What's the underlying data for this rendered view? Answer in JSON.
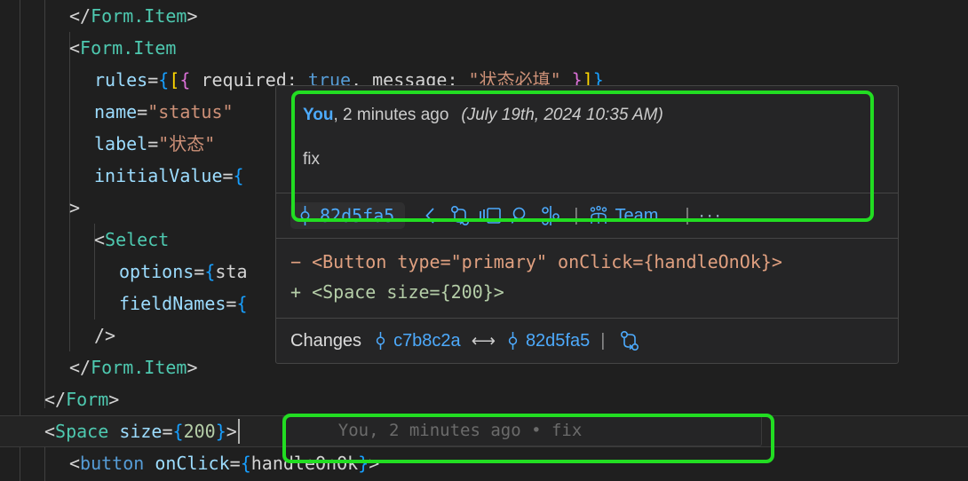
{
  "editor": {
    "lines": [
      {
        "indent": 2,
        "tokens": [
          {
            "t": "</",
            "c": "t-punc"
          },
          {
            "t": "Form.Item",
            "c": "t-tag"
          },
          {
            "t": ">",
            "c": "t-punc"
          }
        ]
      },
      {
        "indent": 2,
        "tokens": [
          {
            "t": "<",
            "c": "t-punc"
          },
          {
            "t": "Form.Item",
            "c": "t-tag"
          }
        ]
      },
      {
        "indent": 3,
        "tokens": [
          {
            "t": "rules",
            "c": "t-attr"
          },
          {
            "t": "=",
            "c": "t-punc"
          },
          {
            "t": "{",
            "c": "t-brace"
          },
          {
            "t": "[",
            "c": "t-brace2"
          },
          {
            "t": "{",
            "c": "t-brace3"
          },
          {
            "t": " required",
            "c": "t-plain"
          },
          {
            "t": ": ",
            "c": "t-punc"
          },
          {
            "t": "true",
            "c": "t-kw"
          },
          {
            "t": ", ",
            "c": "t-punc"
          },
          {
            "t": "message",
            "c": "t-plain"
          },
          {
            "t": ": ",
            "c": "t-punc"
          },
          {
            "t": "\"状态必填\"",
            "c": "t-str"
          },
          {
            "t": " ",
            "c": "t-punc"
          },
          {
            "t": "}",
            "c": "t-brace3"
          },
          {
            "t": "]",
            "c": "t-brace2"
          },
          {
            "t": "}",
            "c": "t-brace"
          }
        ]
      },
      {
        "indent": 3,
        "tokens": [
          {
            "t": "name",
            "c": "t-attr"
          },
          {
            "t": "=",
            "c": "t-punc"
          },
          {
            "t": "\"status\"",
            "c": "t-str"
          }
        ]
      },
      {
        "indent": 3,
        "tokens": [
          {
            "t": "label",
            "c": "t-attr"
          },
          {
            "t": "=",
            "c": "t-punc"
          },
          {
            "t": "\"状态\"",
            "c": "t-str"
          }
        ]
      },
      {
        "indent": 3,
        "tokens": [
          {
            "t": "initialValue",
            "c": "t-attr"
          },
          {
            "t": "=",
            "c": "t-punc"
          },
          {
            "t": "{",
            "c": "t-brace"
          }
        ]
      },
      {
        "indent": 2,
        "tokens": [
          {
            "t": ">",
            "c": "t-punc"
          }
        ]
      },
      {
        "indent": 3,
        "tokens": [
          {
            "t": "<",
            "c": "t-punc"
          },
          {
            "t": "Select",
            "c": "t-tag"
          }
        ]
      },
      {
        "indent": 4,
        "tokens": [
          {
            "t": "options",
            "c": "t-attr"
          },
          {
            "t": "=",
            "c": "t-punc"
          },
          {
            "t": "{",
            "c": "t-brace"
          },
          {
            "t": "sta",
            "c": "t-plain"
          }
        ]
      },
      {
        "indent": 4,
        "tokens": [
          {
            "t": "fieldNames",
            "c": "t-attr"
          },
          {
            "t": "=",
            "c": "t-punc"
          },
          {
            "t": "{",
            "c": "t-brace"
          }
        ]
      },
      {
        "indent": 3,
        "tokens": [
          {
            "t": "/>",
            "c": "t-punc"
          }
        ]
      },
      {
        "indent": 2,
        "tokens": [
          {
            "t": "</",
            "c": "t-punc"
          },
          {
            "t": "Form.Item",
            "c": "t-tag"
          },
          {
            "t": ">",
            "c": "t-punc"
          }
        ]
      },
      {
        "indent": 1,
        "tokens": [
          {
            "t": "</",
            "c": "t-punc"
          },
          {
            "t": "Form",
            "c": "t-tag"
          },
          {
            "t": ">",
            "c": "t-punc"
          }
        ]
      },
      {
        "indent": 1,
        "current": true,
        "tokens": [
          {
            "t": "<",
            "c": "t-punc"
          },
          {
            "t": "Space",
            "c": "t-tag"
          },
          {
            "t": " ",
            "c": "t-punc"
          },
          {
            "t": "size",
            "c": "t-attr"
          },
          {
            "t": "=",
            "c": "t-punc"
          },
          {
            "t": "{",
            "c": "t-brace"
          },
          {
            "t": "200",
            "c": "t-num"
          },
          {
            "t": "}",
            "c": "t-brace"
          },
          {
            "t": ">",
            "c": "t-punc"
          }
        ]
      },
      {
        "indent": 2,
        "tokens": [
          {
            "t": "<",
            "c": "t-punc"
          },
          {
            "t": "button",
            "c": "t-tag2"
          },
          {
            "t": " ",
            "c": "t-punc"
          },
          {
            "t": "onClick",
            "c": "t-attr"
          },
          {
            "t": "=",
            "c": "t-punc"
          },
          {
            "t": "{",
            "c": "t-brace"
          },
          {
            "t": "handleOnOk",
            "c": "t-plain"
          },
          {
            "t": "}",
            "c": "t-brace"
          },
          {
            "t": ">",
            "c": "t-punc"
          }
        ]
      }
    ]
  },
  "hover_panel": {
    "commit_message": {
      "author": "You",
      "relative_time": ", 2 minutes ago",
      "absolute_date": "(July 19th, 2024 10:35 AM)",
      "body": "fix"
    },
    "toolbar": {
      "commit_hash": "82d5fa5",
      "icons": [
        {
          "name": "chevron-left-icon",
          "glyph": "chevron-left"
        },
        {
          "name": "git-compare-icon",
          "glyph": "git-compare"
        },
        {
          "name": "split-view-icon",
          "glyph": "split-view"
        },
        {
          "name": "search-icon",
          "glyph": "magnifier"
        },
        {
          "name": "git-branch-compare-icon",
          "glyph": "branch-compare"
        }
      ],
      "separator": "|",
      "team_label": "Team…",
      "more_label": "···"
    },
    "diff": {
      "removed": "− <Button type=\"primary\" onClick={handleOnOk}>",
      "added": "+ <Space size={200}>"
    },
    "changes": {
      "label": "Changes",
      "from_hash": "c7b8c2a",
      "arrow": "⟷",
      "to_hash": "82d5fa5",
      "separator": "|"
    }
  },
  "blame": {
    "text": "    You, 2 minutes ago • fix"
  },
  "colors": {
    "highlight_outline": "#22dd22",
    "panel_bg": "#252526",
    "editor_bg": "#1f1f1f",
    "link_blue": "#4daafc",
    "diff_remove": "#e0a080",
    "diff_add": "#b5cea8"
  }
}
